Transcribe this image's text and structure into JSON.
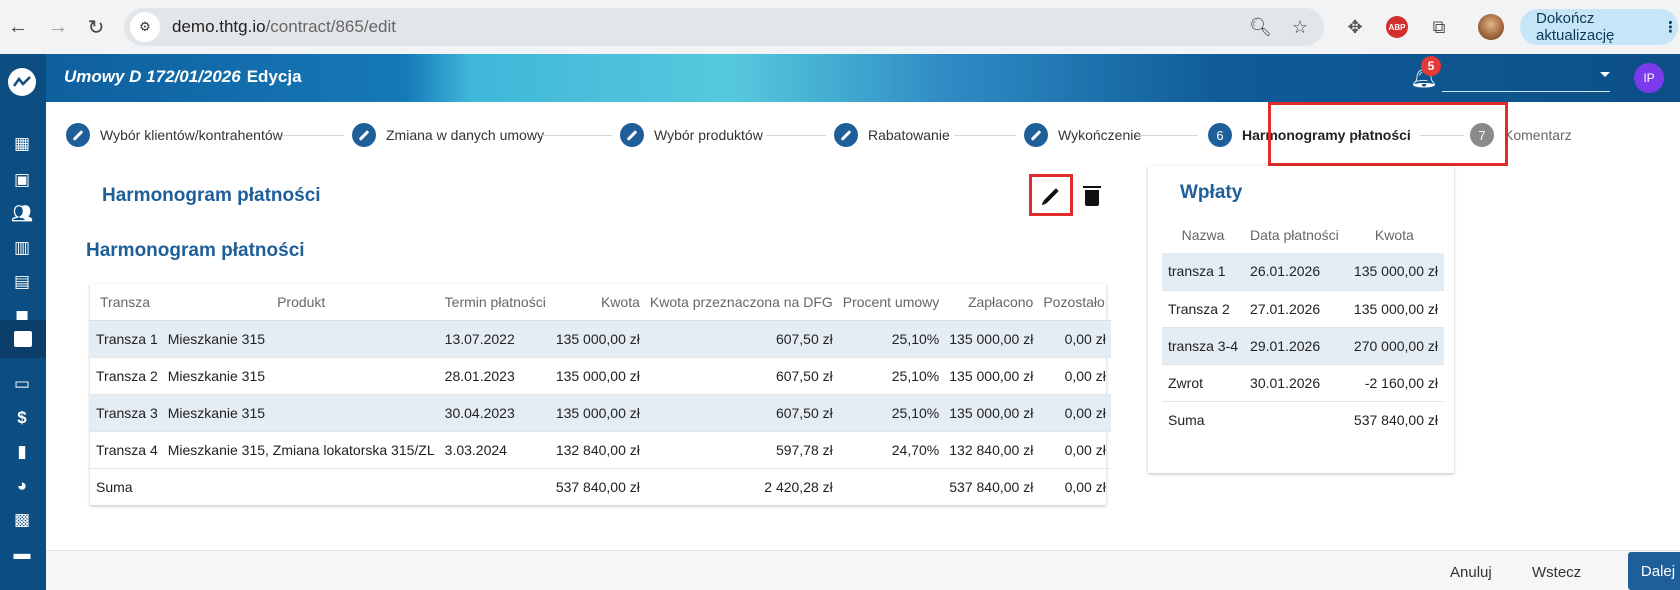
{
  "browser": {
    "url_host": "demo.thtg.io",
    "url_path": "/contract/865/edit",
    "update_button": "Dokończ aktualizację",
    "extension_abp": "ABP"
  },
  "header": {
    "title": "Umowy  D 172/01/2026",
    "mode": "Edycja",
    "notifications_count": "5",
    "user_initials": "IP"
  },
  "stepper": {
    "steps": [
      {
        "label": "Wybór klientów/kontrahentów",
        "state": "done"
      },
      {
        "label": "Zmiana w danych umowy",
        "state": "done"
      },
      {
        "label": "Wybór produktów",
        "state": "done"
      },
      {
        "label": "Rabatowanie",
        "state": "done"
      },
      {
        "label": "Wykończenie",
        "state": "done"
      },
      {
        "label": "Harmonogramy płatności",
        "number": "6",
        "state": "active"
      },
      {
        "label": "Komentarz",
        "number": "7",
        "state": "pending"
      }
    ]
  },
  "schedule": {
    "section_title": "Harmonogram płatności",
    "table_title": "Harmonogram płatności",
    "columns": [
      "Transza",
      "Produkt",
      "Termin płatności",
      "Kwota",
      "Kwota przeznaczona na DFG",
      "Procent umowy",
      "Zapłacono",
      "Pozostało"
    ],
    "rows": [
      [
        "Transza 1",
        "Mieszkanie 315",
        "13.07.2022",
        "135 000,00 zł",
        "607,50 zł",
        "25,10%",
        "135 000,00 zł",
        "0,00 zł"
      ],
      [
        "Transza 2",
        "Mieszkanie 315",
        "28.01.2023",
        "135 000,00 zł",
        "607,50 zł",
        "25,10%",
        "135 000,00 zł",
        "0,00 zł"
      ],
      [
        "Transza 3",
        "Mieszkanie 315",
        "30.04.2023",
        "135 000,00 zł",
        "607,50 zł",
        "25,10%",
        "135 000,00 zł",
        "0,00 zł"
      ],
      [
        "Transza 4",
        "Mieszkanie 315, Zmiana lokatorska 315/ZL",
        "3.03.2024",
        "132 840,00 zł",
        "597,78 zł",
        "24,70%",
        "132 840,00 zł",
        "0,00 zł"
      ]
    ],
    "sum": {
      "label": "Suma",
      "amount": "537 840,00 zł",
      "dfg": "2 420,28 zł",
      "paid": "537 840,00 zł",
      "remaining": "0,00 zł"
    }
  },
  "payments": {
    "title": "Wpłaty",
    "columns": [
      "Nazwa",
      "Data płatności",
      "Kwota"
    ],
    "rows": [
      [
        "transza 1",
        "26.01.2026",
        "135 000,00 zł"
      ],
      [
        "Transza 2",
        "27.01.2026",
        "135 000,00 zł"
      ],
      [
        "transza 3-4",
        "29.01.2026",
        "270 000,00 zł"
      ],
      [
        "Zwrot",
        "30.01.2026",
        "-2 160,00 zł"
      ]
    ],
    "sum": {
      "label": "Suma",
      "amount": "537 840,00 zł"
    }
  },
  "footer": {
    "cancel": "Anuluj",
    "back": "Wstecz",
    "next": "Dalej"
  },
  "colors": {
    "primary": "#1f5f99",
    "sidebar": "#0d4e82",
    "highlight": "#e02b2b",
    "row_alt": "#e5edf4"
  }
}
